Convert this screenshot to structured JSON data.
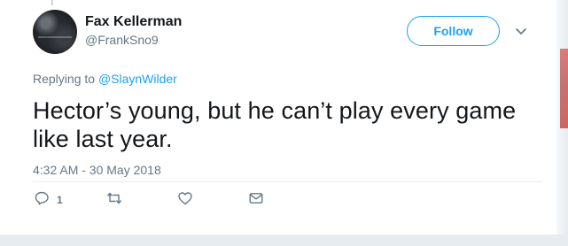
{
  "author": {
    "name": "Fax Kellerman",
    "handle": "@FrankSno9"
  },
  "follow_button": {
    "label": "Follow"
  },
  "reply_context": {
    "prefix": "Replying to",
    "mention": "@SlaynWilder"
  },
  "tweet": {
    "text": "Hector’s young, but he can’t play every game like last year.",
    "timestamp": "4:32 AM - 30 May 2018"
  },
  "actions": {
    "reply_count": "1"
  },
  "colors": {
    "accent": "#1da1f2",
    "secondary_text": "#657786",
    "primary_text": "#14171a"
  },
  "icons": [
    "caret-down-icon",
    "reply-icon",
    "retweet-icon",
    "like-icon",
    "direct-message-icon"
  ]
}
